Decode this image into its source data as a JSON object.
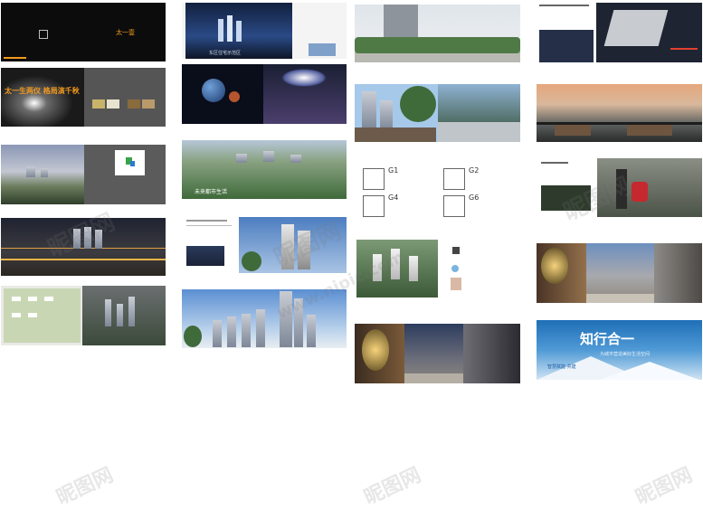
{
  "panel1": {
    "title": "太一壹"
  },
  "panel2": {
    "headline": "太一生两仪 格局演千秋"
  },
  "panel3": {
    "caption": "东区住宅示范区"
  },
  "panel4": {
    "caption": "未来都市生活"
  },
  "floorplans": {
    "labels": [
      "G1",
      "G2",
      "G4",
      "G6"
    ]
  },
  "amenity": {
    "label": "景观示范区"
  },
  "banner": {
    "title": "知行合一",
    "subtitle": "为城市营造美好生活空间",
    "tagline": "智慧赋能 共建"
  },
  "watermark": {
    "site": "昵图网",
    "url": "www.nipic.com"
  },
  "colors": {
    "accent": "#f29a1e",
    "dark": "#111111",
    "sky": "#1f6fb7"
  }
}
